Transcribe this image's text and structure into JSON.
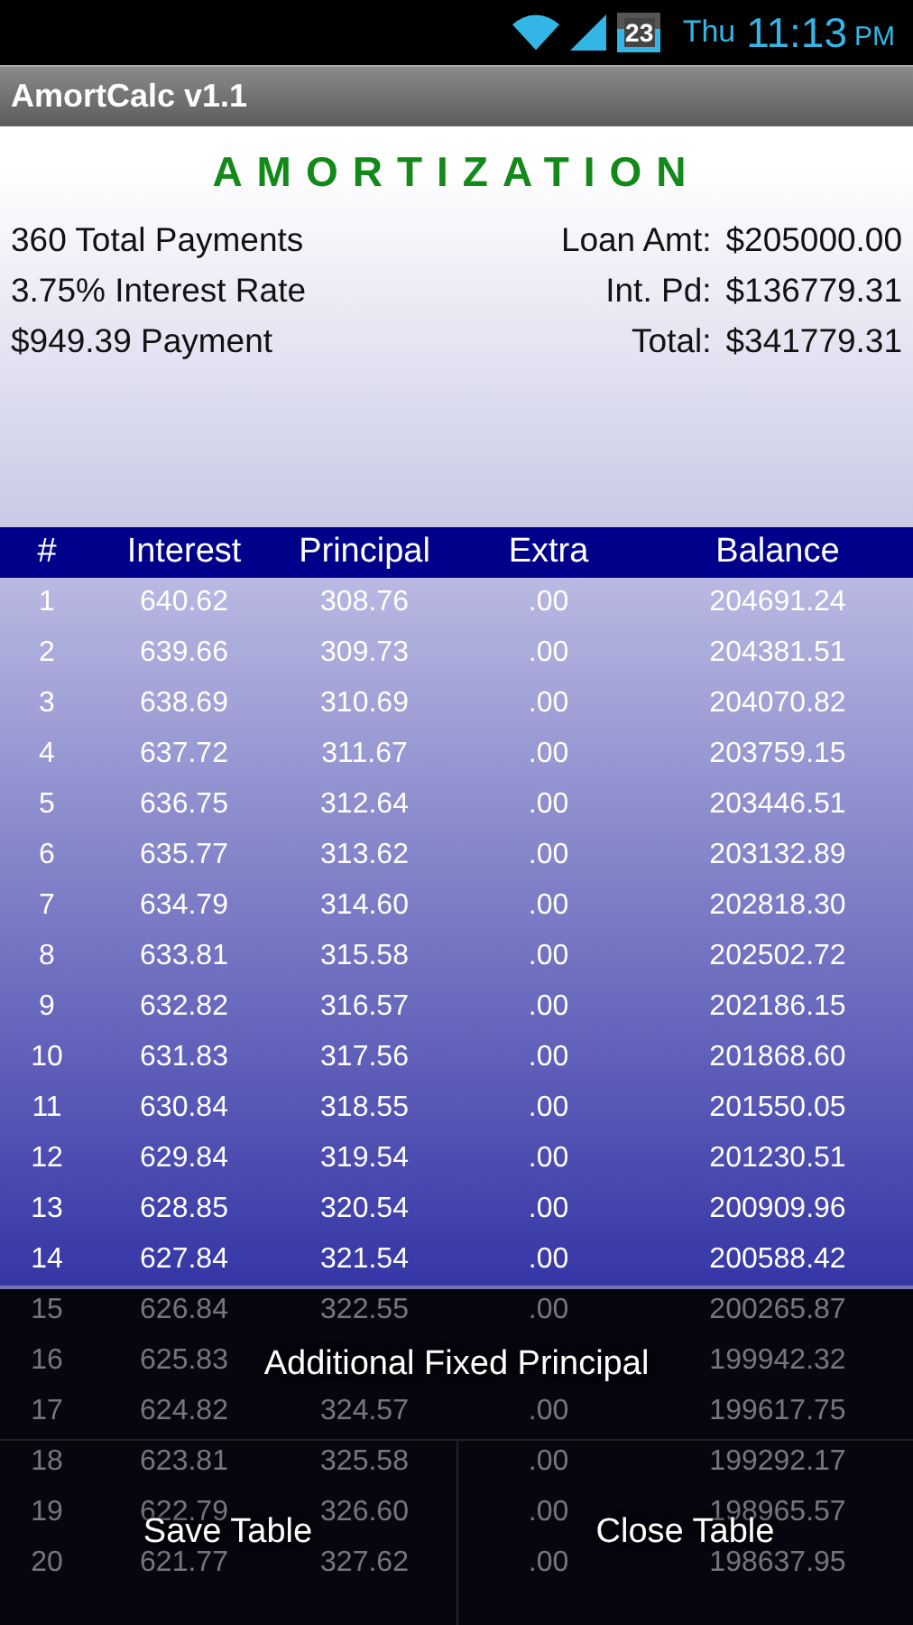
{
  "status_bar": {
    "battery": "23",
    "day": "Thu",
    "time": "11:13",
    "ampm": "PM"
  },
  "window": {
    "title": "AmortCalc v1.1"
  },
  "summary": {
    "title": "AMORTIZATION",
    "left": [
      "360 Total Payments",
      "3.75% Interest Rate",
      "$949.39 Payment"
    ],
    "right": [
      {
        "label": "Loan Amt:",
        "value": "$205000.00"
      },
      {
        "label": "Int. Pd:",
        "value": "$136779.31"
      },
      {
        "label": "Total:",
        "value": "$341779.31"
      }
    ]
  },
  "table": {
    "columns": [
      "#",
      "Interest",
      "Principal",
      "Extra",
      "Balance"
    ],
    "rows": [
      [
        "1",
        "640.62",
        "308.76",
        ".00",
        "204691.24"
      ],
      [
        "2",
        "639.66",
        "309.73",
        ".00",
        "204381.51"
      ],
      [
        "3",
        "638.69",
        "310.69",
        ".00",
        "204070.82"
      ],
      [
        "4",
        "637.72",
        "311.67",
        ".00",
        "203759.15"
      ],
      [
        "5",
        "636.75",
        "312.64",
        ".00",
        "203446.51"
      ],
      [
        "6",
        "635.77",
        "313.62",
        ".00",
        "203132.89"
      ],
      [
        "7",
        "634.79",
        "314.60",
        ".00",
        "202818.30"
      ],
      [
        "8",
        "633.81",
        "315.58",
        ".00",
        "202502.72"
      ],
      [
        "9",
        "632.82",
        "316.57",
        ".00",
        "202186.15"
      ],
      [
        "10",
        "631.83",
        "317.56",
        ".00",
        "201868.60"
      ],
      [
        "11",
        "630.84",
        "318.55",
        ".00",
        "201550.05"
      ],
      [
        "12",
        "629.84",
        "319.54",
        ".00",
        "201230.51"
      ],
      [
        "13",
        "628.85",
        "320.54",
        ".00",
        "200909.96"
      ],
      [
        "14",
        "627.84",
        "321.54",
        ".00",
        "200588.42"
      ],
      [
        "15",
        "626.84",
        "322.55",
        ".00",
        "200265.87"
      ],
      [
        "16",
        "625.83",
        null,
        null,
        "199942.32"
      ],
      [
        "17",
        "624.82",
        "324.57",
        ".00",
        "199617.75"
      ],
      [
        "18",
        "623.81",
        "325.58",
        ".00",
        "199292.17"
      ],
      [
        "19",
        "622.79",
        "326.60",
        ".00",
        "198965.57"
      ],
      [
        "20",
        "621.77",
        "327.62",
        ".00",
        "198637.95"
      ]
    ]
  },
  "menu": {
    "items": [
      "Additional Fixed Principal",
      "Save Table",
      "Close Table"
    ]
  }
}
